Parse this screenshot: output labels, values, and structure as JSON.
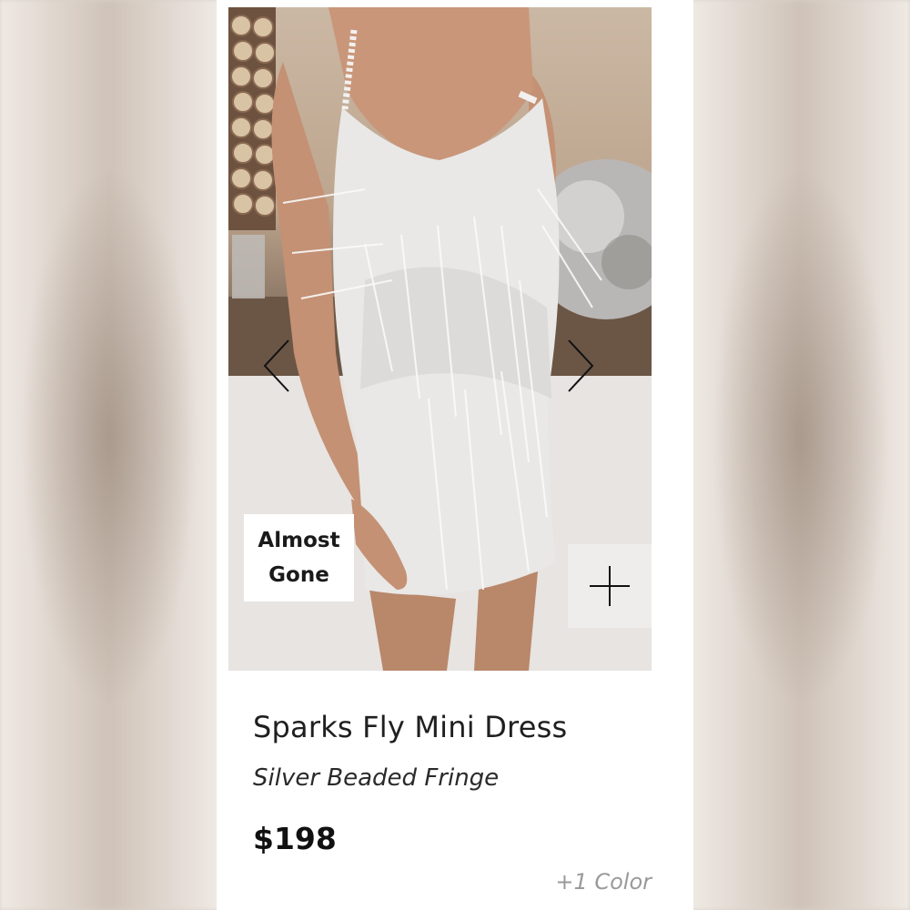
{
  "product": {
    "badge": {
      "line1": "Almost",
      "line2": "Gone"
    },
    "title": "Sparks Fly Mini Dress",
    "subtitle": "Silver Beaded Fringe",
    "price": "$198",
    "more_colors": "+1 Color"
  },
  "icons": {
    "prev": "chevron-left-icon",
    "next": "chevron-right-icon",
    "add": "plus-icon"
  },
  "colors": {
    "card_bg": "#ffffff",
    "badge_bg": "#ffffff",
    "text_primary": "#1f1f1f",
    "text_muted": "#9a9a9a"
  }
}
